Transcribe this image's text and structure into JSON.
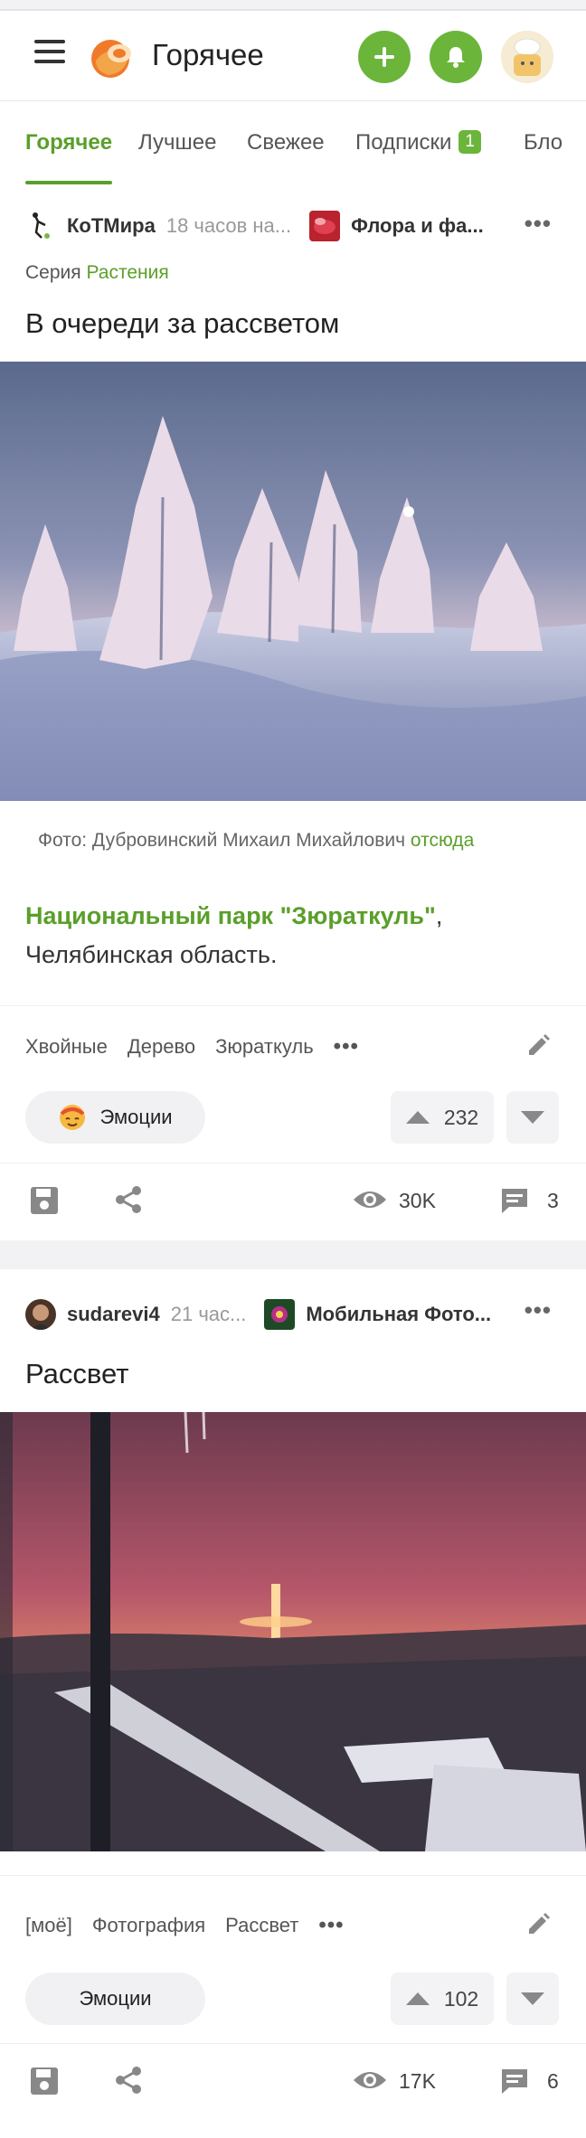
{
  "header": {
    "title": "Горячее"
  },
  "tabs": [
    {
      "label": "Горячее"
    },
    {
      "label": "Лучшее"
    },
    {
      "label": "Свежее"
    },
    {
      "label": "Подписки",
      "badge": "1"
    },
    {
      "label": "Бло"
    }
  ],
  "posts": [
    {
      "author": "КоТМира",
      "time": "18 часов на...",
      "community": "Флора и фа...",
      "series_label": "Серия",
      "series_name": "Растения",
      "title": "В очереди за рассветом",
      "caption_prefix": "Фото: Дубровинский Михаил Михайлович",
      "caption_link": "отсюда",
      "body_link": "Национальный парк \"Зюраткуль\"",
      "body_comma": ",",
      "body_rest": "Челябинская область.",
      "tags": [
        "Хвойные",
        "Дерево",
        "Зюраткуль"
      ],
      "emotions_label": "Эмоции",
      "rating": "232",
      "views": "30K",
      "comments": "3"
    },
    {
      "author": "sudarevi4",
      "time": "21 час...",
      "community": "Мобильная Фото...",
      "title": "Рассвет",
      "tags": [
        "[моё]",
        "Фотография",
        "Рассвет"
      ],
      "emotions_label": "Эмоции",
      "rating": "102",
      "views": "17K",
      "comments": "6"
    }
  ],
  "colors": {
    "accent": "#5a9f2a",
    "button_green": "#6bb53b"
  },
  "icons": [
    "menu-icon",
    "logo-icon",
    "plus-icon",
    "bell-icon",
    "more-icon",
    "pencil-icon",
    "arrow-up-icon",
    "arrow-down-icon",
    "save-icon",
    "share-icon",
    "eye-icon",
    "comment-icon"
  ]
}
